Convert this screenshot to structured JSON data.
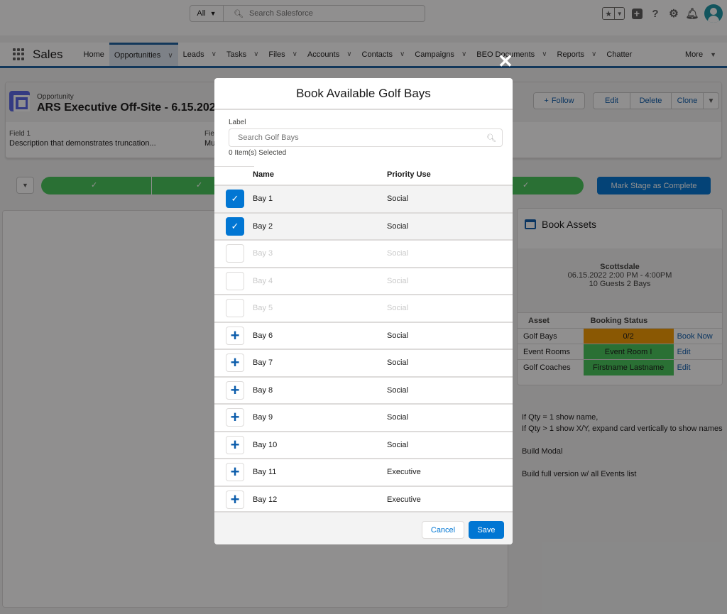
{
  "global_header": {
    "search_scope": "All",
    "search_placeholder": "Search Salesforce",
    "icons": [
      "favorites-star-icon",
      "favorites-dropdown-icon",
      "global-add-icon",
      "help-icon",
      "setup-gear-icon",
      "notifications-bell-icon",
      "user-avatar-icon"
    ]
  },
  "nav": {
    "app_name": "Sales",
    "items": [
      {
        "label": "Home",
        "has_menu": false,
        "active": false
      },
      {
        "label": "Opportunities",
        "has_menu": true,
        "active": true
      },
      {
        "label": "Leads",
        "has_menu": true,
        "active": false
      },
      {
        "label": "Tasks",
        "has_menu": true,
        "active": false
      },
      {
        "label": "Files",
        "has_menu": true,
        "active": false
      },
      {
        "label": "Accounts",
        "has_menu": true,
        "active": false
      },
      {
        "label": "Contacts",
        "has_menu": true,
        "active": false
      },
      {
        "label": "Campaigns",
        "has_menu": true,
        "active": false
      },
      {
        "label": "BEO Documents",
        "has_menu": true,
        "active": false
      },
      {
        "label": "Reports",
        "has_menu": true,
        "active": false
      },
      {
        "label": "Chatter",
        "has_menu": false,
        "active": false
      }
    ],
    "more_label": "More"
  },
  "record": {
    "type": "Opportunity",
    "title": "ARS Executive Off-Site - 6.15.2022 - ...",
    "follow_label": "Follow",
    "actions": [
      "Edit",
      "Delete",
      "Clone"
    ],
    "fields": [
      {
        "label": "Field 1",
        "value": "Description that demonstrates truncation..."
      },
      {
        "label": "Fie",
        "value": "Mu"
      }
    ]
  },
  "path": {
    "mark_complete_label": "Mark Stage as Complete"
  },
  "book_assets": {
    "title": "Book Assets",
    "location": "Scottsdale",
    "datetime": "06.15.2022 2:00 PM - 4:00PM",
    "guests": "10 Guests 2 Bays",
    "columns": [
      "Asset",
      "Booking Status"
    ],
    "rows": [
      {
        "asset": "Golf Bays",
        "status": "0/2",
        "status_color": "#f59b00",
        "action": "Book Now"
      },
      {
        "asset": "Event Rooms",
        "status": "Event Room I",
        "status_color": "#45c65a",
        "action": "Edit"
      },
      {
        "asset": "Golf Coaches",
        "status": "Firstname Lastname",
        "status_color": "#45c65a",
        "action": "Edit"
      }
    ]
  },
  "notes": [
    "If Qty = 1 show name,",
    "If Qty > 1 show X/Y, expand card vertically to show names",
    "Build Modal",
    "Build full version w/ all Events list"
  ],
  "modal": {
    "title": "Book Available Golf Bays",
    "search_label": "Label",
    "search_placeholder": "Search Golf Bays",
    "selected_count": "0 Item(s) Selected",
    "columns": {
      "name": "Name",
      "priority": "Priority Use"
    },
    "rows": [
      {
        "name": "Bay 1",
        "priority": "Social",
        "state": "selected"
      },
      {
        "name": "Bay 2",
        "priority": "Social",
        "state": "selected"
      },
      {
        "name": "Bay 3",
        "priority": "Social",
        "state": "disabled"
      },
      {
        "name": "Bay 4",
        "priority": "Social",
        "state": "disabled"
      },
      {
        "name": "Bay 5",
        "priority": "Social",
        "state": "disabled"
      },
      {
        "name": "Bay 6",
        "priority": "Social",
        "state": "add"
      },
      {
        "name": "Bay 7",
        "priority": "Social",
        "state": "add"
      },
      {
        "name": "Bay 8",
        "priority": "Social",
        "state": "add"
      },
      {
        "name": "Bay 9",
        "priority": "Social",
        "state": "add"
      },
      {
        "name": "Bay 10",
        "priority": "Social",
        "state": "add"
      },
      {
        "name": "Bay 11",
        "priority": "Executive",
        "state": "add"
      },
      {
        "name": "Bay 12",
        "priority": "Executive",
        "state": "add"
      }
    ],
    "cancel_label": "Cancel",
    "save_label": "Save"
  },
  "colors": {
    "brand_blue": "#0176d3",
    "path_green": "#45c65a",
    "warning_orange": "#f59b00",
    "nav_accent": "#1b5f9e"
  }
}
